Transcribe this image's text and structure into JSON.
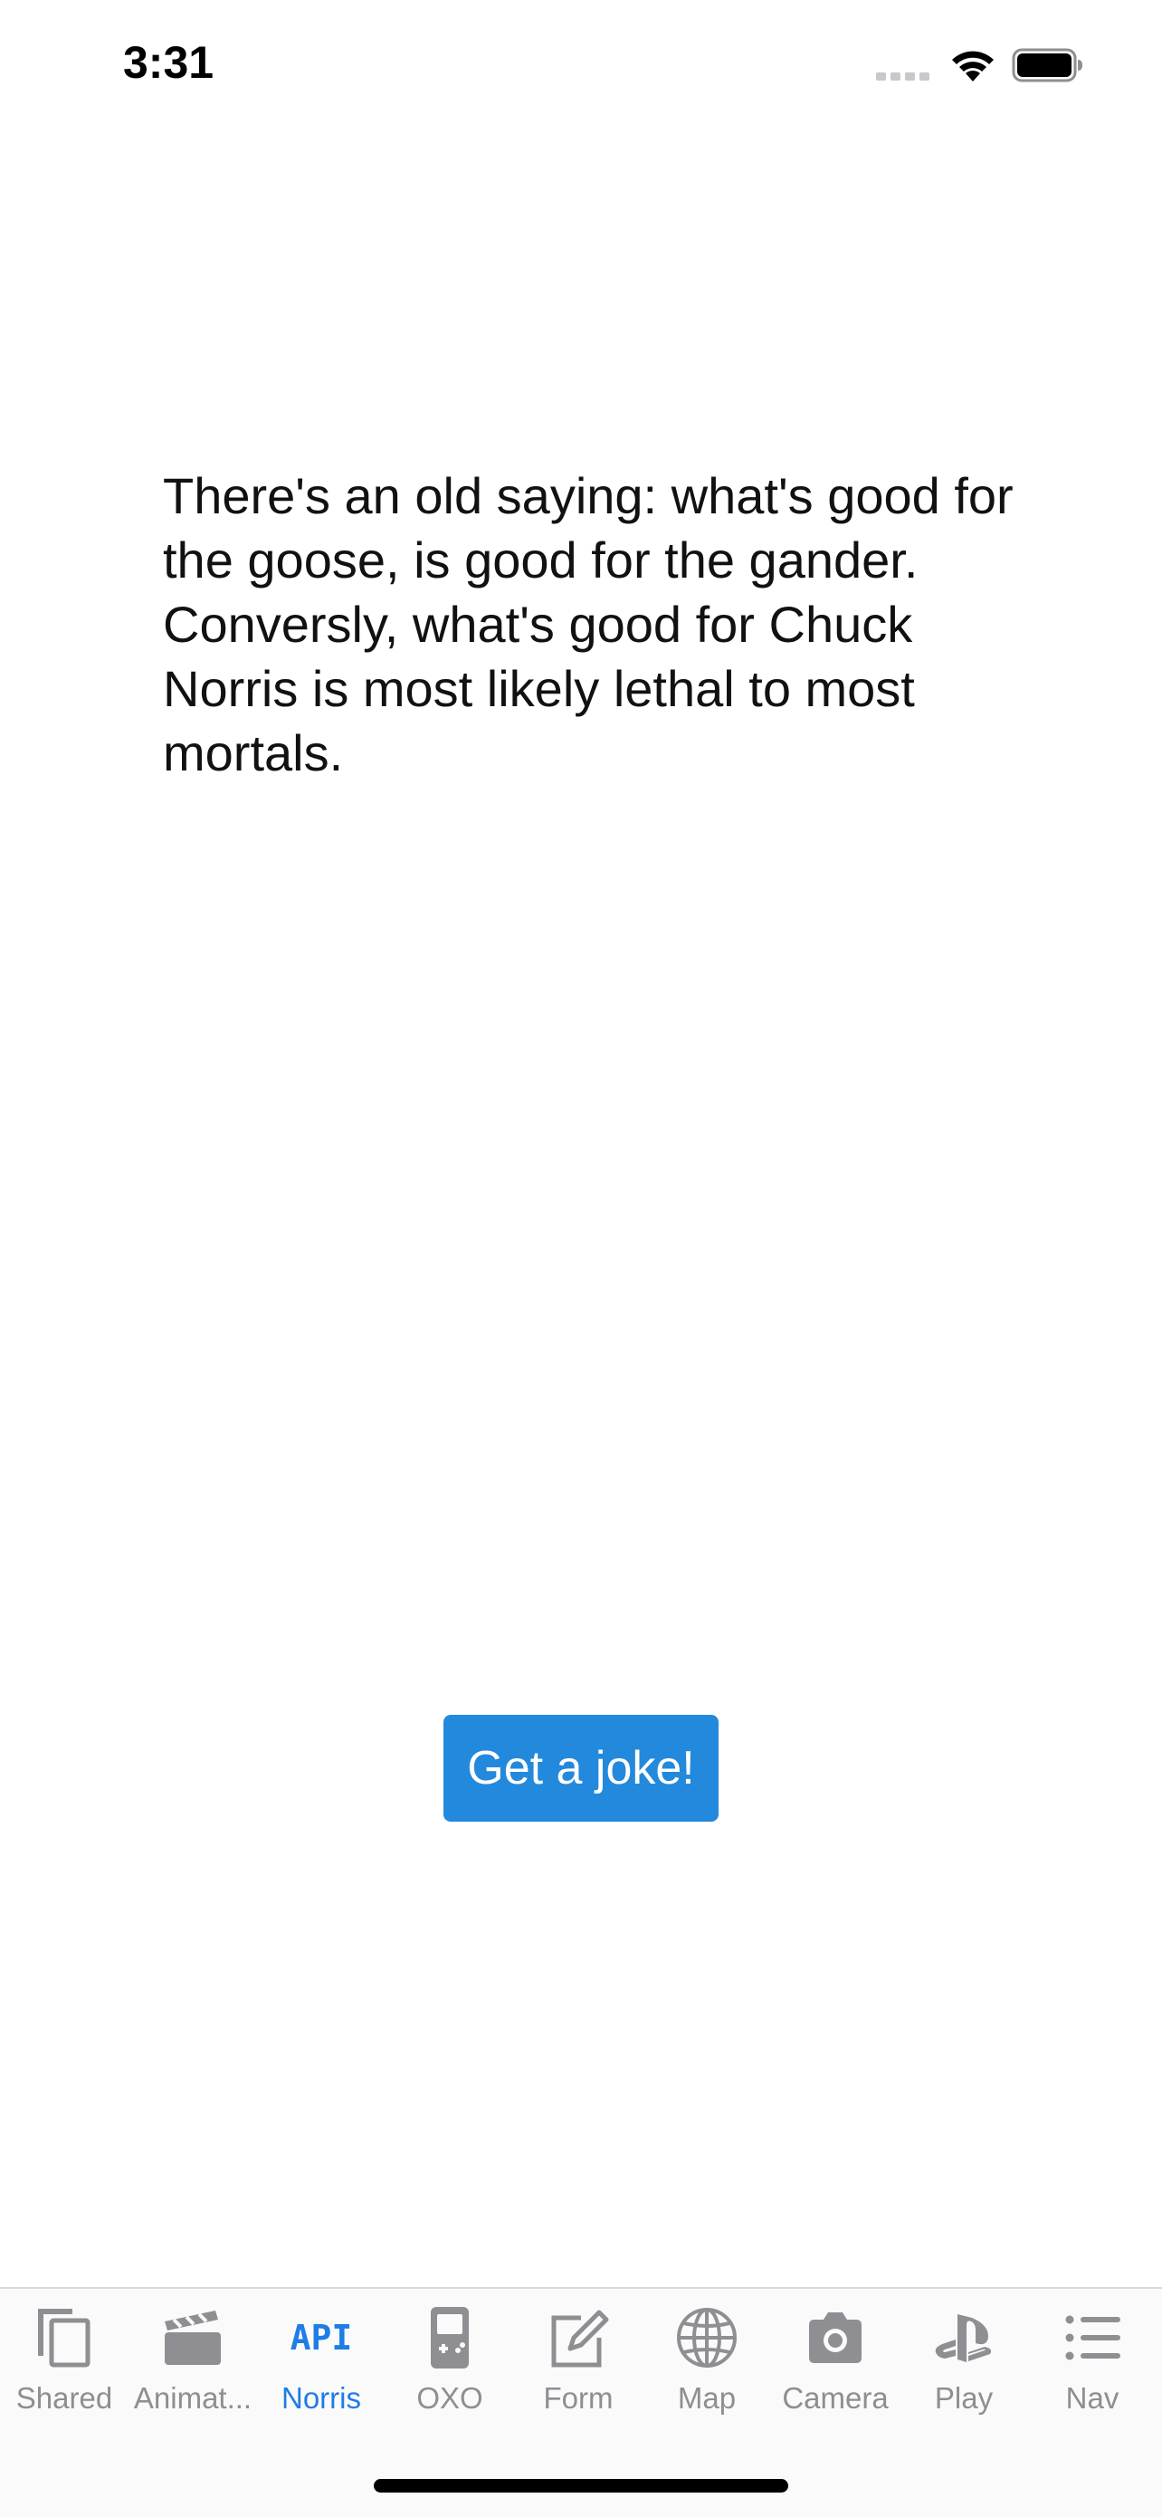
{
  "status_bar": {
    "time": "3:31"
  },
  "main": {
    "joke": "There's an old saying: what's good for the goose, is good for the gander. Conversly, what's good for Chuck Norris is most likely lethal to most mortals.",
    "button_label": "Get a joke!"
  },
  "tab_bar": {
    "active_index": 2,
    "tabs": [
      {
        "label": "Shared",
        "icon": "copy-icon"
      },
      {
        "label": "Animat...",
        "icon": "clapperboard-icon"
      },
      {
        "label": "Norris",
        "icon": "api-icon",
        "icon_text": "API"
      },
      {
        "label": "OXO",
        "icon": "gameboy-icon"
      },
      {
        "label": "Form",
        "icon": "edit-icon"
      },
      {
        "label": "Map",
        "icon": "globe-icon"
      },
      {
        "label": "Camera",
        "icon": "camera-icon"
      },
      {
        "label": "Play",
        "icon": "playstation-icon"
      },
      {
        "label": "Nav",
        "icon": "list-icon"
      }
    ]
  },
  "colors": {
    "accent": "#1f7de6",
    "button": "#2389dc",
    "inactive_tab": "#8e8e93"
  }
}
